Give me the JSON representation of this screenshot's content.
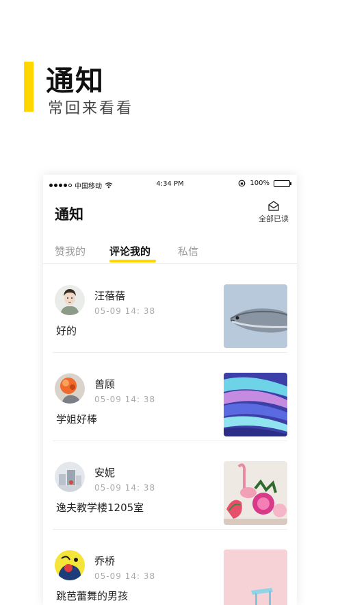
{
  "hero": {
    "title": "通知",
    "subtitle": "常回来看看"
  },
  "status_bar": {
    "carrier": "中国移动",
    "time": "4:34 PM",
    "battery": "100%"
  },
  "header": {
    "title": "通知",
    "read_all_label": "全部已读"
  },
  "tabs": [
    {
      "label": "赞我的",
      "active": false
    },
    {
      "label": "评论我的",
      "active": true
    },
    {
      "label": "私信",
      "active": false
    }
  ],
  "comments": [
    {
      "name": "汪蓓蓓",
      "date": "05-09 14: 38",
      "text": "好的"
    },
    {
      "name": "曾顾",
      "date": "05-09 14: 38",
      "text": "学姐好棒"
    },
    {
      "name": "安妮",
      "date": "05-09 14: 38",
      "text": "逸夫教学楼1205室"
    },
    {
      "name": "乔桥",
      "date": "05-09 14: 38",
      "text": "跳芭蕾舞的男孩"
    }
  ],
  "colors": {
    "accent": "#FFD600",
    "muted": "#999999"
  }
}
